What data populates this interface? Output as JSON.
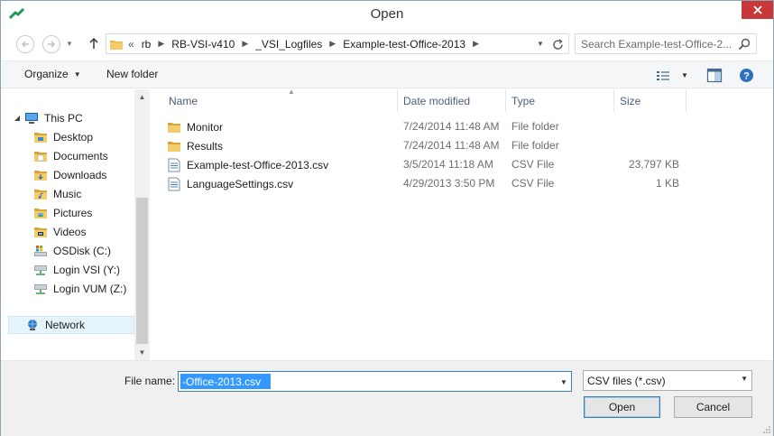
{
  "window": {
    "title": "Open"
  },
  "address": {
    "overflow_chevron": "«",
    "crumbs": [
      "rb",
      "RB-VSI-v410",
      "_VSI_Logfiles",
      "Example-test-Office-2013"
    ]
  },
  "search": {
    "placeholder": "Search Example-test-Office-2..."
  },
  "toolbar": {
    "organize_label": "Organize",
    "new_folder_label": "New folder"
  },
  "nav_pane": {
    "items": [
      {
        "label": "This PC",
        "icon": "computer-icon"
      },
      {
        "label": "Desktop",
        "icon": "folder-icon"
      },
      {
        "label": "Documents",
        "icon": "folder-icon"
      },
      {
        "label": "Downloads",
        "icon": "folder-icon"
      },
      {
        "label": "Music",
        "icon": "folder-icon"
      },
      {
        "label": "Pictures",
        "icon": "folder-icon"
      },
      {
        "label": "Videos",
        "icon": "folder-icon"
      },
      {
        "label": "OSDisk (C:)",
        "icon": "drive-icon"
      },
      {
        "label": "Login VSI (Y:)",
        "icon": "network-drive-icon"
      },
      {
        "label": "Login VUM (Z:)",
        "icon": "network-drive-icon"
      },
      {
        "label": "Network",
        "icon": "network-icon"
      }
    ]
  },
  "file_list": {
    "columns": [
      "Name",
      "Date modified",
      "Type",
      "Size"
    ],
    "rows": [
      {
        "name": "Monitor",
        "date": "7/24/2014 11:48 AM",
        "type": "File folder",
        "size": "",
        "icon": "folder-icon"
      },
      {
        "name": "Results",
        "date": "7/24/2014 11:48 AM",
        "type": "File folder",
        "size": "",
        "icon": "folder-icon"
      },
      {
        "name": "Example-test-Office-2013.csv",
        "date": "3/5/2014 11:18 AM",
        "type": "CSV File",
        "size": "23,797 KB",
        "icon": "csv-file-icon"
      },
      {
        "name": "LanguageSettings.csv",
        "date": "4/29/2013 3:50 PM",
        "type": "CSV File",
        "size": "1 KB",
        "icon": "csv-file-icon"
      }
    ]
  },
  "bottom": {
    "file_name_label": "File name:",
    "file_name_value": "-Office-2013.csv",
    "filter_value": "CSV files (*.csv)",
    "open_label": "Open",
    "cancel_label": "Cancel"
  },
  "colors": {
    "close": "#c7383a",
    "folder": "#e8b84a",
    "selection": "#3399ff",
    "accent": "#3c7fb1"
  }
}
